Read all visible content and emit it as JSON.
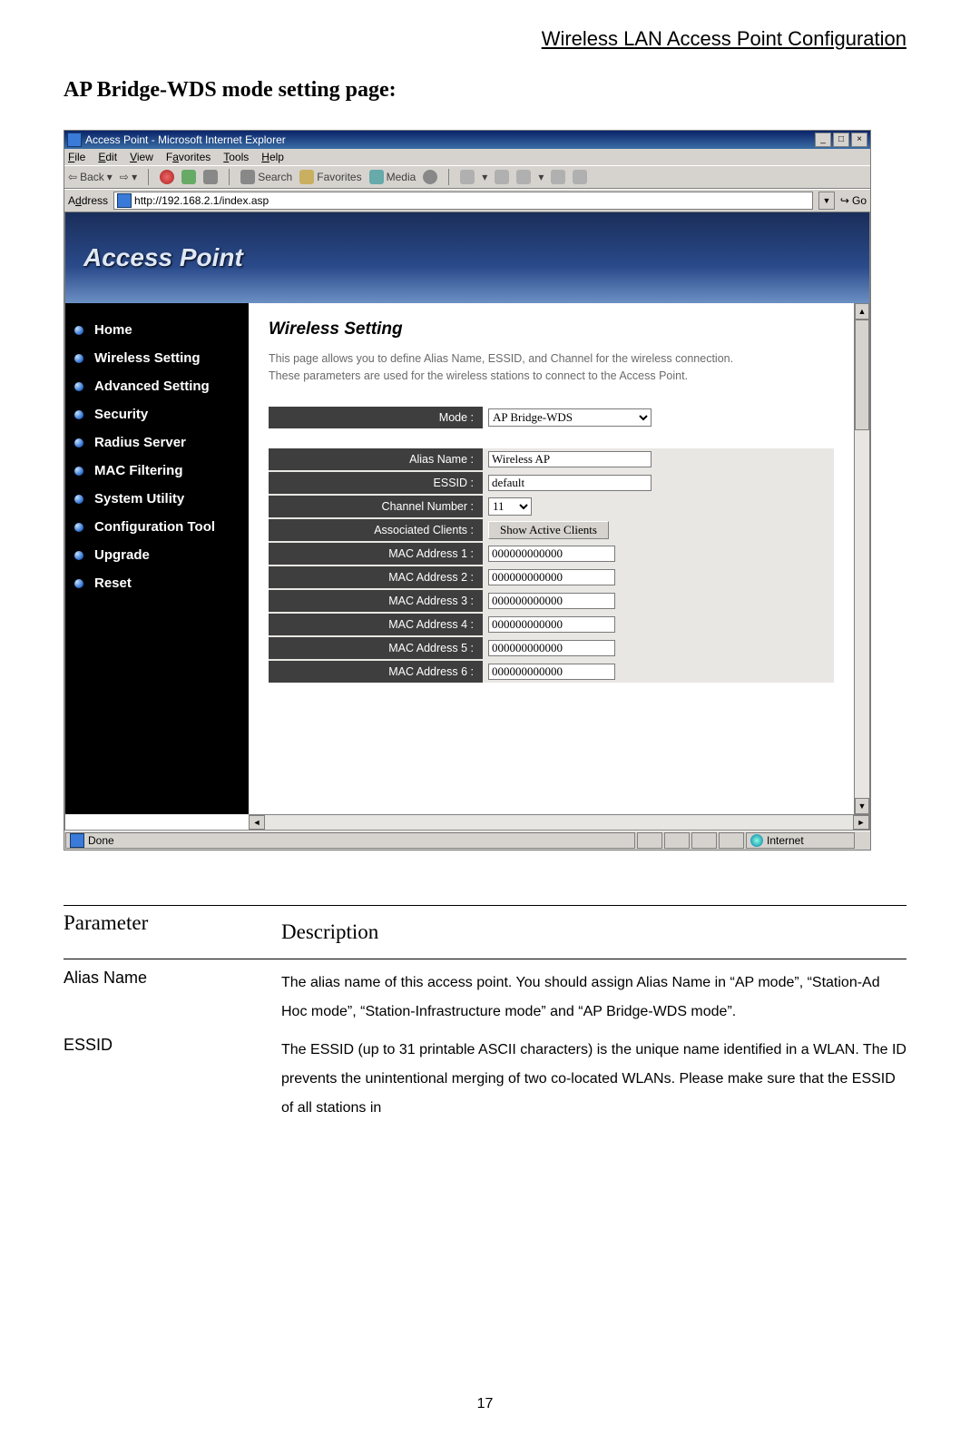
{
  "doc": {
    "header": "Wireless LAN Access Point Configuration",
    "section_title": "AP Bridge-WDS mode setting page:",
    "page_number": "17"
  },
  "window": {
    "title": "Access Point - Microsoft Internet Explorer",
    "min": "_",
    "max": "□",
    "close": "×"
  },
  "menu": {
    "file": "File",
    "edit": "Edit",
    "view": "View",
    "favorites": "Favorites",
    "tools": "Tools",
    "help": "Help"
  },
  "toolbar": {
    "back": "Back",
    "search": "Search",
    "favorites": "Favorites",
    "media": "Media"
  },
  "address": {
    "label": "Address",
    "url": "http://192.168.2.1/index.asp",
    "go": "Go"
  },
  "hero": {
    "title": "Access Point"
  },
  "sidebar": {
    "items": [
      {
        "label": "Home"
      },
      {
        "label": "Wireless Setting"
      },
      {
        "label": "Advanced Setting"
      },
      {
        "label": "Security"
      },
      {
        "label": "Radius Server"
      },
      {
        "label": "MAC Filtering"
      },
      {
        "label": "System Utility"
      },
      {
        "label": "Configuration Tool"
      },
      {
        "label": "Upgrade"
      },
      {
        "label": "Reset"
      }
    ]
  },
  "content": {
    "heading": "Wireless Setting",
    "description": "This page allows you to define Alias Name, ESSID, and Channel for the wireless connection. These parameters are used for the wireless stations to connect to the Access Point.",
    "labels": {
      "mode": "Mode :",
      "alias": "Alias Name :",
      "essid": "ESSID :",
      "channel": "Channel Number :",
      "assoc": "Associated Clients :",
      "mac1": "MAC Address 1 :",
      "mac2": "MAC Address 2 :",
      "mac3": "MAC Address 3 :",
      "mac4": "MAC Address 4 :",
      "mac5": "MAC Address 5 :",
      "mac6": "MAC Address 6 :"
    },
    "values": {
      "mode": "AP Bridge-WDS",
      "alias": "Wireless AP",
      "essid": "default",
      "channel": "11",
      "show_clients_btn": "Show Active Clients",
      "mac1": "000000000000",
      "mac2": "000000000000",
      "mac3": "000000000000",
      "mac4": "000000000000",
      "mac5": "000000000000",
      "mac6": "000000000000"
    }
  },
  "status": {
    "done": "Done",
    "zone": "Internet"
  },
  "param_table": {
    "hdr_param": "Parameter",
    "hdr_desc": "Description",
    "rows": [
      {
        "p": "Alias Name",
        "d": "The alias name of this access point. You should assign Alias Name in “AP mode”, “Station-Ad Hoc mode”, “Station-Infrastructure mode” and “AP Bridge-WDS mode”."
      },
      {
        "p": "ESSID",
        "d": "The ESSID (up to 31 printable ASCII characters) is the unique name identified in a WLAN. The ID prevents the unintentional merging of two co-located WLANs. Please make sure that the ESSID of all stations in"
      }
    ]
  }
}
